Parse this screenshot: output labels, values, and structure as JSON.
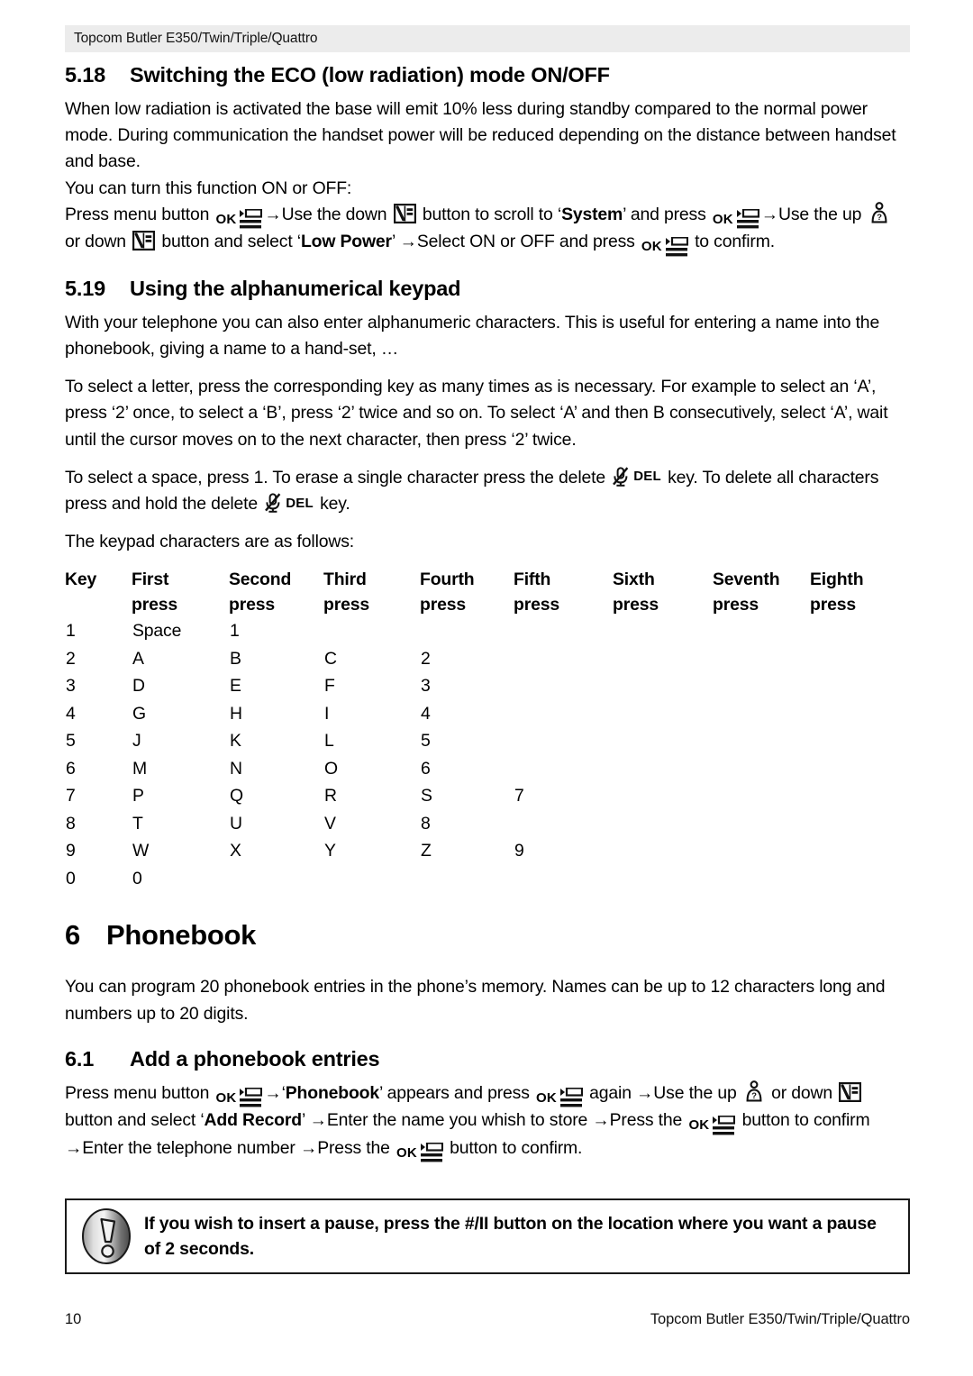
{
  "header": {
    "running_title": "Topcom Butler E350/Twin/Triple/Quattro"
  },
  "sections": {
    "s518": {
      "number": "5.18",
      "title": "Switching the ECO (low radiation) mode ON/OFF",
      "p1": "When low radiation is activated the base will emit 10% less during standby compared to the normal power mode. During communication the handset power will be reduced depending on the distance between handset and base.",
      "p2": "You can turn this function ON or OFF:",
      "steps": {
        "t1": "Press menu button ",
        "t2": "→Use the down ",
        "t3": " button to scroll to ‘",
        "b1": "System",
        "t4": "’ and press ",
        "t5": "→Use the up ",
        "t6": " or down ",
        "t7": " button and select ‘",
        "b2": "Low Power",
        "t8": "’ →Select ON or OFF and press ",
        "t9": " to confirm."
      }
    },
    "s519": {
      "number": "5.19",
      "title": "Using the alphanumerical keypad",
      "p1": "With your telephone you can also enter alphanumeric characters. This is useful for entering a name into the phonebook, giving a name to a hand-set, …",
      "p2": "To select a letter, press the corresponding key as many times as is necessary. For example to select an ‘A’, press ‘2’ once, to select a ‘B’, press ‘2’ twice and so on. To select ‘A’ and then B consecutively, select ‘A’, wait until the cursor moves on to the next character, then press ‘2’ twice.",
      "p3": {
        "t1": "To select a space, press 1.  To erase a single character press the delete ",
        "t2": " key. To delete all characters press and hold the delete ",
        "t3": " key."
      },
      "p4": "The keypad characters are as follows:"
    },
    "s6": {
      "number": "6",
      "title": "Phonebook",
      "p1": "You can program 20 phonebook entries in the phone’s memory. Names can be up to 12 characters long and numbers up to 20 digits."
    },
    "s61": {
      "number": "6.1",
      "title": "Add a phonebook entries",
      "steps": {
        "t1": "Press menu button ",
        "t2": "→‘",
        "b1": "Phonebook",
        "t3": "’ appears and press ",
        "t4": " again →Use the up ",
        "t5": " or down ",
        "t6": " button and select ‘",
        "b2": "Add Record",
        "t7": "’ →Enter the name you whish to store →Press the ",
        "t8": " button to confirm →Enter the telephone number →Press the ",
        "t9": " button to confirm."
      }
    }
  },
  "keypad_table": {
    "columns": [
      "Key",
      "First press",
      "Second press",
      "Third press",
      "Fourth press",
      "Fifth press",
      "Sixth press",
      "Seventh press",
      "Eighth press"
    ],
    "column_head_line1": [
      "Key",
      "First",
      "Second",
      "Third",
      "Fourth",
      "Fifth",
      "Sixth",
      "Seventh",
      "Eighth"
    ],
    "column_head_line2": [
      "",
      "press",
      "press",
      "press",
      "press",
      "press",
      "press",
      "press",
      "press"
    ],
    "rows": [
      [
        "1",
        "Space",
        "1",
        "",
        "",
        "",
        "",
        "",
        ""
      ],
      [
        "2",
        "A",
        "B",
        "C",
        "2",
        "",
        "",
        "",
        ""
      ],
      [
        "3",
        "D",
        "E",
        "F",
        "3",
        "",
        "",
        "",
        ""
      ],
      [
        "4",
        "G",
        "H",
        "I",
        "4",
        "",
        "",
        "",
        ""
      ],
      [
        "5",
        "J",
        "K",
        "L",
        "5",
        "",
        "",
        "",
        ""
      ],
      [
        "6",
        "M",
        "N",
        "O",
        "6",
        "",
        "",
        "",
        ""
      ],
      [
        "7",
        "P",
        "Q",
        "R",
        "S",
        "7",
        "",
        "",
        ""
      ],
      [
        "8",
        "T",
        "U",
        "V",
        "8",
        "",
        "",
        "",
        ""
      ],
      [
        "9",
        "W",
        "X",
        "Y",
        "Z",
        "9",
        "",
        "",
        ""
      ],
      [
        "0",
        "0",
        "",
        "",
        "",
        "",
        "",
        "",
        ""
      ]
    ]
  },
  "note": {
    "text": "If you wish to insert a pause, press the #/II button on the location where you want a pause of 2 seconds."
  },
  "icons": {
    "ok_label": "OK",
    "del_label": "DEL"
  },
  "footer": {
    "page_number": "10",
    "title": "Topcom Butler E350/Twin/Triple/Quattro"
  },
  "colors": {
    "header_band": "#ececec",
    "text": "#000000",
    "note_border": "#1a1a1a"
  }
}
